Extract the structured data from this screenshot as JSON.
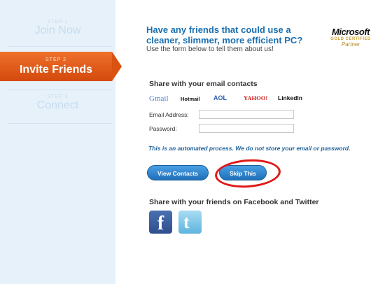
{
  "steps": [
    {
      "num": "STEP 1",
      "name": "Join Now"
    },
    {
      "num": "STEP 2",
      "name": "Invite Friends"
    },
    {
      "num": "STEP 3",
      "name": "Connect"
    }
  ],
  "header": {
    "headline": "Have any friends that could use a cleaner, slimmer, more efficient PC?",
    "subline": "Use the form below to tell them about us!"
  },
  "partner_logo": {
    "brand": "Microsoft",
    "tier": "GOLD CERTIFIED",
    "label": "Partner"
  },
  "email_section": {
    "title": "Share with your email contacts",
    "providers": [
      "Gmail",
      "Hotmail",
      "AOL",
      "YAHOO!",
      "LinkedIn"
    ],
    "email_label": "Email Address:",
    "password_label": "Password:",
    "email_value": "",
    "password_value": "",
    "note": "This is an automated process. We do not store your email or password.",
    "view_button": "View Contacts",
    "skip_button": "Skip This"
  },
  "social_section": {
    "title": "Share with your friends on Facebook and Twitter",
    "icons": [
      "facebook-icon",
      "twitter-icon"
    ]
  },
  "colors": {
    "accent": "#1a6fb0",
    "step_active": "#e05a14",
    "highlight": "#e01818"
  }
}
